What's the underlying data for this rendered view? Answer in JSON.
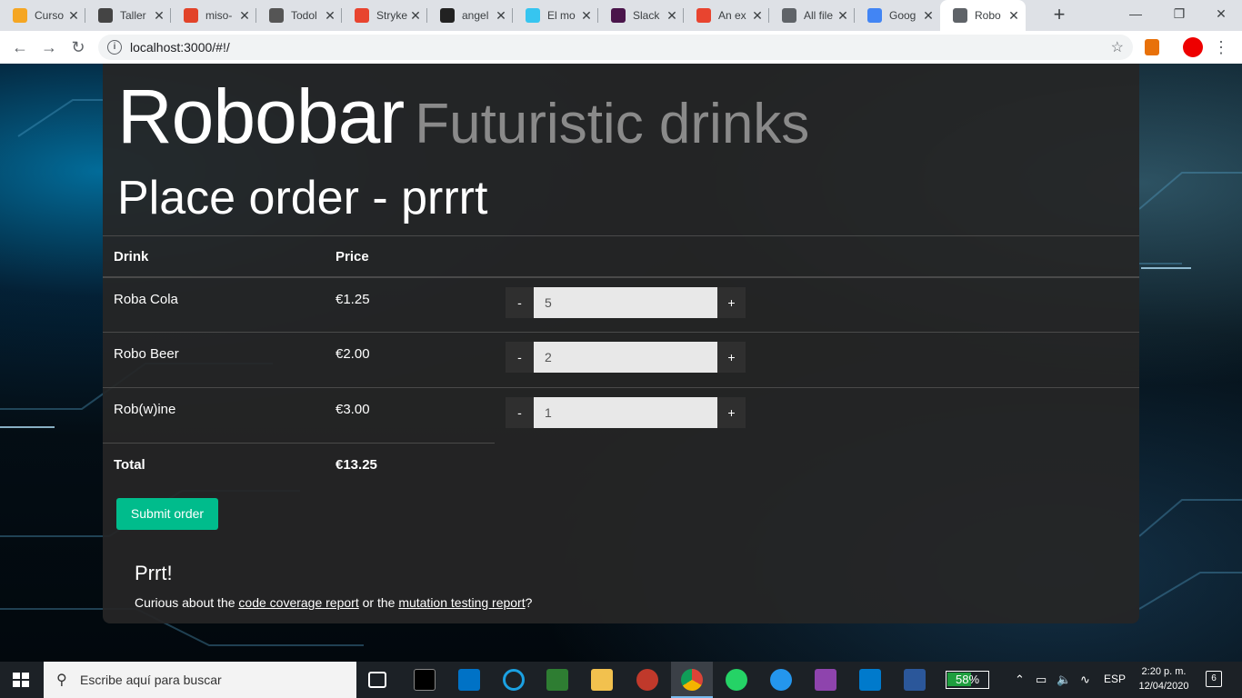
{
  "browser": {
    "tabs": [
      {
        "title": "Curso",
        "icon": "coursera-favicon-icon",
        "color": "#f5a623"
      },
      {
        "title": "Taller",
        "icon": "book-favicon-icon",
        "color": "#444444"
      },
      {
        "title": "miso-",
        "icon": "gitlab-favicon-icon",
        "color": "#e24329"
      },
      {
        "title": "Todol",
        "icon": "checkbox-favicon-icon",
        "color": "#555555"
      },
      {
        "title": "Stryke",
        "icon": "stryker-favicon-icon",
        "color": "#e8442f"
      },
      {
        "title": "angel",
        "icon": "github-favicon-icon",
        "color": "#222222"
      },
      {
        "title": "El mo",
        "icon": "slack-favicon-icon",
        "color": "#36c5f0"
      },
      {
        "title": "Slack",
        "icon": "slack-app-favicon-icon",
        "color": "#4a154b"
      },
      {
        "title": "An ex",
        "icon": "stryker-favicon-icon",
        "color": "#e8442f"
      },
      {
        "title": "All file",
        "icon": "globe-favicon-icon",
        "color": "#5f6368"
      },
      {
        "title": "Goog",
        "icon": "google-translate-favicon-icon",
        "color": "#4285f4"
      },
      {
        "title": "Robo",
        "icon": "globe-favicon-icon",
        "color": "#5f6368"
      }
    ],
    "url": "localhost:3000/#!/"
  },
  "page": {
    "brand_name": "Robobar",
    "brand_tagline": "Futuristic drinks",
    "heading": "Place order - prrrt",
    "table": {
      "headers": [
        "Drink",
        "Price"
      ],
      "rows": [
        {
          "drink": "Roba Cola",
          "price": "€1.25",
          "quantity": "5"
        },
        {
          "drink": "Robo Beer",
          "price": "€2.00",
          "quantity": "2"
        },
        {
          "drink": "Rob(w)ine",
          "price": "€3.00",
          "quantity": "1"
        }
      ],
      "decrement_label": "-",
      "increment_label": "+",
      "total_label": "Total",
      "total_value": "€13.25"
    },
    "submit_label": "Submit order",
    "footer": {
      "title": "Prrt!",
      "text_before": "Curious about the ",
      "link1": "code coverage report",
      "text_middle": " or the ",
      "link2": "mutation testing report",
      "text_after": "?"
    },
    "colors": {
      "accent": "#00bc8c",
      "panel": "#262626"
    }
  },
  "taskbar": {
    "search_placeholder": "Escribe aquí para buscar",
    "battery": {
      "label": "58%",
      "level": 0.58
    },
    "language": "ESP",
    "time": "2:20 p. m.",
    "date": "12/04/2020",
    "notifications": "6"
  }
}
